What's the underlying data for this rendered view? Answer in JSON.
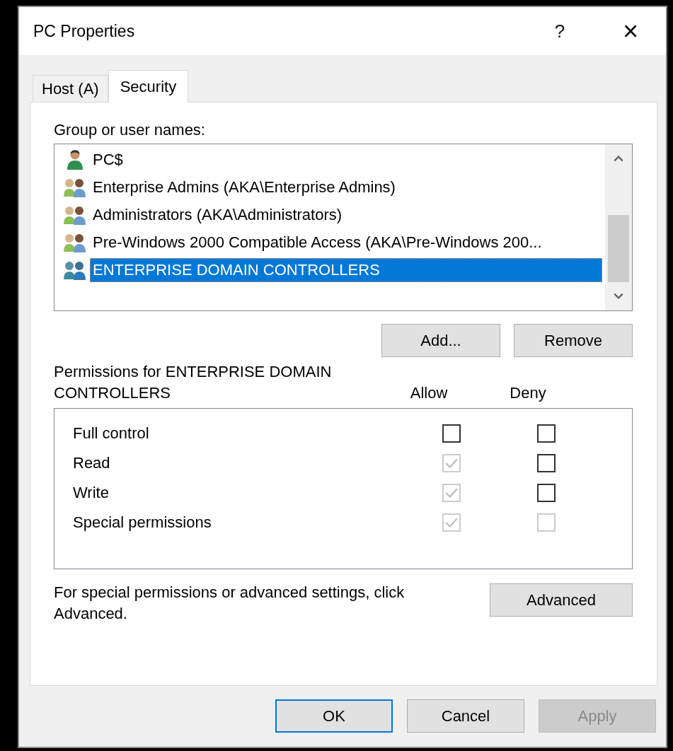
{
  "window": {
    "title": "PC Properties",
    "help": "?",
    "close": "×"
  },
  "tabs": [
    {
      "label": "Host (A)",
      "selected": false
    },
    {
      "label": "Security",
      "selected": true
    }
  ],
  "names_label": "Group or user names:",
  "principals": [
    {
      "kind": "user",
      "name": "PC$",
      "selected": false
    },
    {
      "kind": "group",
      "name": "Enterprise Admins (AKA\\Enterprise Admins)",
      "selected": false
    },
    {
      "kind": "group",
      "name": "Administrators (AKA\\Administrators)",
      "selected": false
    },
    {
      "kind": "group",
      "name": "Pre-Windows 2000 Compatible Access (AKA\\Pre-Windows 200...",
      "selected": false
    },
    {
      "kind": "group",
      "name": "ENTERPRISE DOMAIN CONTROLLERS",
      "selected": true
    }
  ],
  "list_buttons": [
    "Add...",
    "Remove"
  ],
  "permissions_label": "Permissions for ENTERPRISE DOMAIN CONTROLLERS",
  "columns": [
    "Allow",
    "Deny"
  ],
  "permissions": [
    {
      "name": "Full control",
      "allow": {
        "checked": false,
        "disabled": false
      },
      "deny": {
        "checked": false,
        "disabled": false
      }
    },
    {
      "name": "Read",
      "allow": {
        "checked": true,
        "disabled": true
      },
      "deny": {
        "checked": false,
        "disabled": false
      }
    },
    {
      "name": "Write",
      "allow": {
        "checked": true,
        "disabled": true
      },
      "deny": {
        "checked": false,
        "disabled": false
      }
    },
    {
      "name": "Special permissions",
      "allow": {
        "checked": true,
        "disabled": true
      },
      "deny": {
        "checked": false,
        "disabled": true
      }
    }
  ],
  "advanced_text": "For special permissions or advanced settings, click Advanced.",
  "advanced_button": "Advanced",
  "buttons": [
    {
      "label": "OK",
      "default": true,
      "disabled": false
    },
    {
      "label": "Cancel",
      "default": false,
      "disabled": false
    },
    {
      "label": "Apply",
      "default": false,
      "disabled": true
    }
  ]
}
